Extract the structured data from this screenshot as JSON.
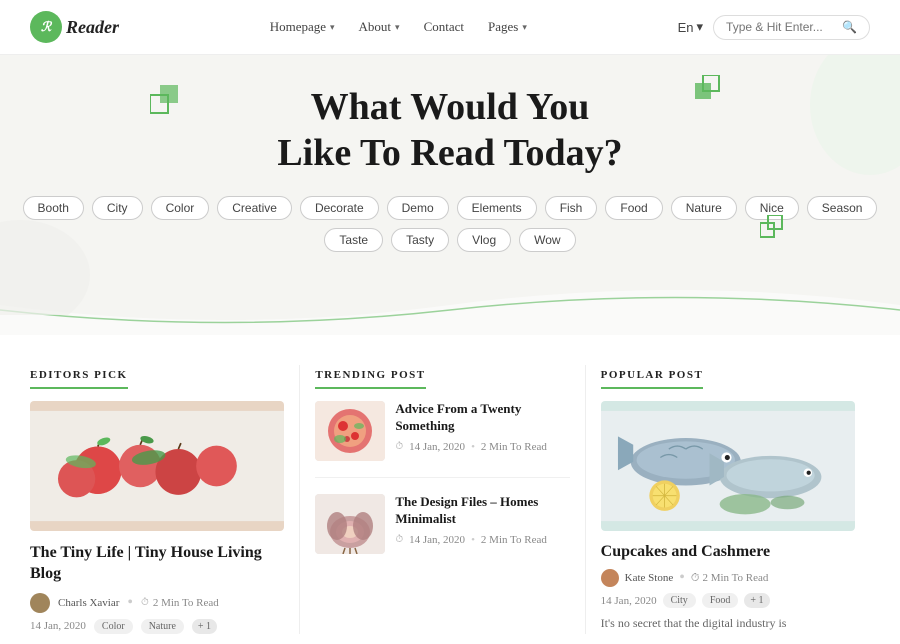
{
  "brand": {
    "logo_initial": "R",
    "name": "Reader"
  },
  "nav": {
    "links": [
      {
        "label": "Homepage",
        "has_arrow": true
      },
      {
        "label": "About",
        "has_arrow": true
      },
      {
        "label": "Contact",
        "has_arrow": false
      },
      {
        "label": "Pages",
        "has_arrow": true
      }
    ],
    "lang": "En",
    "search_placeholder": "Type & Hit Enter..."
  },
  "hero": {
    "title_line1": "What Would You",
    "title_line2": "Like To Read Today?",
    "tags": [
      "Booth",
      "City",
      "Color",
      "Creative",
      "Decorate",
      "Demo",
      "Elements",
      "Fish",
      "Food",
      "Nature",
      "Nice",
      "Season",
      "Taste",
      "Tasty",
      "Vlog",
      "Wow"
    ]
  },
  "sections": {
    "editors_pick": {
      "section_title": "EDITORS PICK",
      "article_title": "The Tiny Life | Tiny House Living Blog",
      "author_name": "Charls Xaviar",
      "read_time": "2 Min To Read",
      "date": "14 Jan, 2020",
      "tags": [
        "Color",
        "Nature"
      ],
      "plus": "+ 1"
    },
    "trending_post": {
      "section_title": "TRENDING POST",
      "items": [
        {
          "title": "Advice From a Twenty Something",
          "date": "14 Jan, 2020",
          "read_time": "2 Min To Read"
        },
        {
          "title": "The Design Files – Homes Minimalist",
          "date": "14 Jan, 2020",
          "read_time": "2 Min To Read"
        }
      ]
    },
    "popular_post": {
      "section_title": "POPULAR POST",
      "article_title": "Cupcakes and Cashmere",
      "author_name": "Kate Stone",
      "read_time": "2 Min To Read",
      "date": "14 Jan, 2020",
      "tags": [
        "City",
        "Food"
      ],
      "plus": "+ 1",
      "description": "It's no secret that the digital industry is"
    }
  }
}
